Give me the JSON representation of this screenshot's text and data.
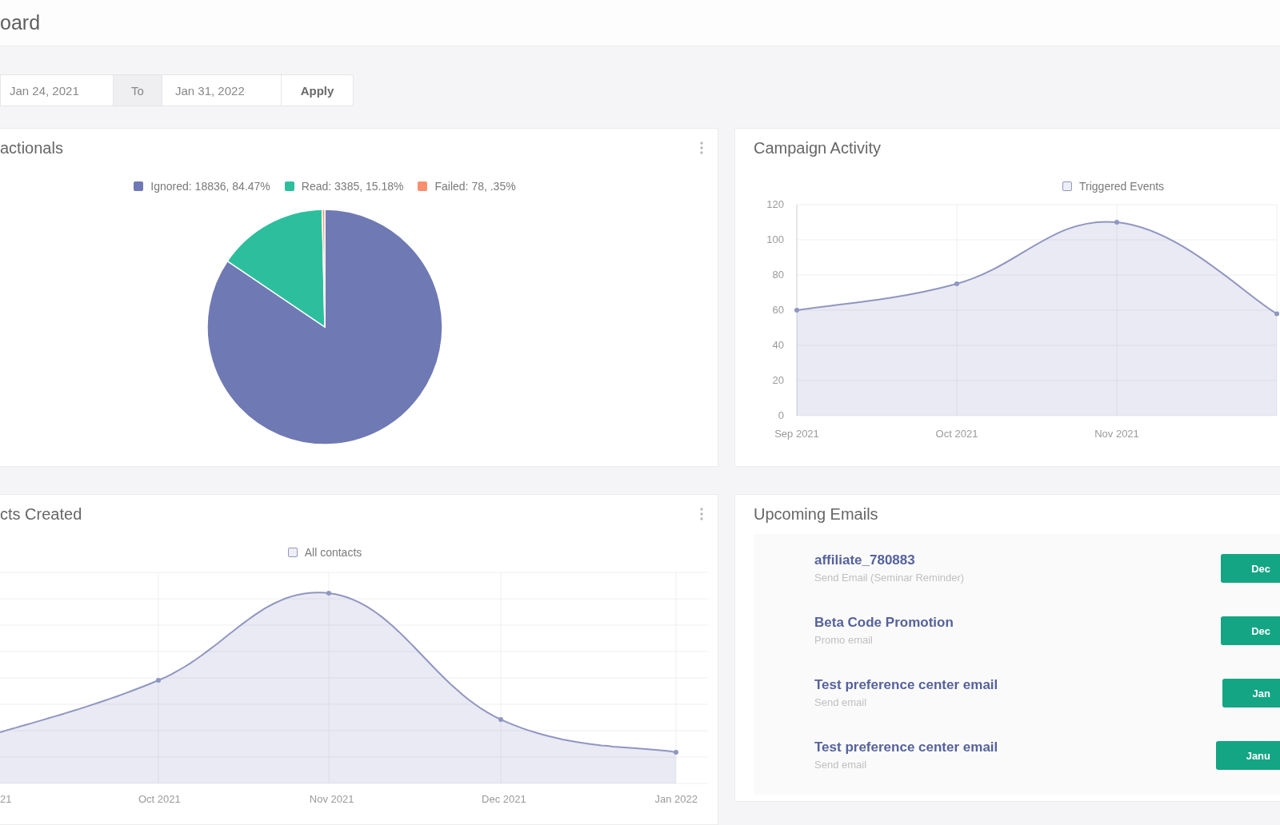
{
  "header": {
    "title": "oard"
  },
  "date_filter": {
    "from": "Jan 24, 2021",
    "separator": "To",
    "to": "Jan 31, 2022",
    "apply": "Apply"
  },
  "widgets": [
    {
      "kind": "pie",
      "title": "actionals",
      "menu": true,
      "chart_data": {
        "type": "pie",
        "categories": [
          "Ignored: 18836, 84.47%",
          "Read: 3385, 15.18%",
          "Failed: 78, .35%"
        ],
        "values": [
          18836,
          3385,
          78
        ],
        "colors": [
          "#6f79b3",
          "#2dbf9d",
          "#f98f6e"
        ],
        "legend": "top"
      }
    },
    {
      "kind": "line",
      "title": "Campaign Activity",
      "menu": false,
      "chart_data": {
        "type": "area",
        "categories": [
          "Sep 2021",
          "Oct 2021",
          "Nov 2021",
          null
        ],
        "series": [
          {
            "name": "Triggered Events",
            "color": "#9096c1",
            "values": [
              60,
              75,
              110,
              58
            ]
          }
        ],
        "ylim": [
          0,
          120
        ],
        "yticks": [
          0,
          20,
          40,
          60,
          80,
          100,
          120
        ],
        "grid": true,
        "legend": "top",
        "marker": "circle"
      }
    },
    {
      "kind": "area_picture",
      "title": "cts Created",
      "menu": true,
      "legend": "All contacts",
      "x_labels": [
        "21",
        "Oct 2021",
        "Nov 2021",
        "Dec 2021",
        "Jan 2022"
      ]
    },
    {
      "kind": "list",
      "title": "Upcoming Emails",
      "menu": false,
      "items": [
        {
          "name": "affiliate_780883",
          "event": "Send Email (Seminar Reminder)",
          "badge": "Dec"
        },
        {
          "name": "Beta Code Promotion",
          "event": "Promo email",
          "badge": "Dec"
        },
        {
          "name": "Test preference center email",
          "event": "Send email",
          "badge": "Jan"
        },
        {
          "name": "Test preference center email",
          "event": "Send email",
          "badge": "Janu"
        }
      ]
    }
  ]
}
